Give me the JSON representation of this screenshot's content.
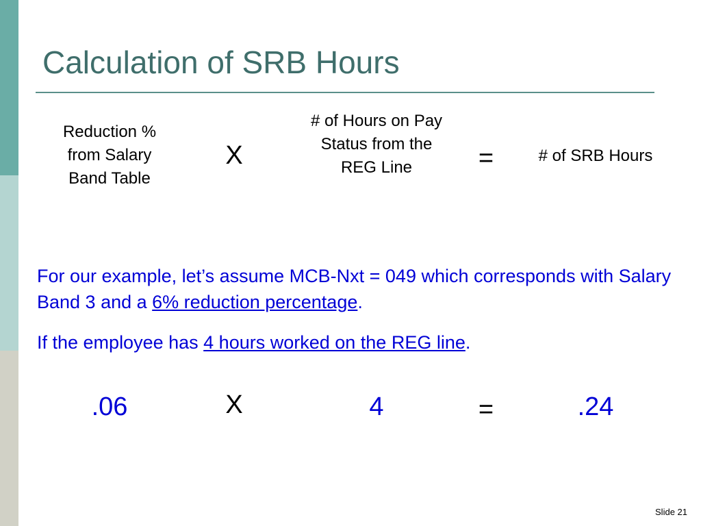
{
  "slide": {
    "title": "Calculation of SRB Hours",
    "formula": {
      "term1": "Reduction % from Salary Band Table",
      "operator1": "X",
      "term2": "# of Hours on Pay Status from the REG Line",
      "operator2": "=",
      "result": "# of SRB Hours"
    },
    "example": {
      "para1_text": "For our example, let’s assume MCB-Nxt = 049 which corresponds with Salary Band 3 and a ",
      "para1_link": "6% reduction percentage",
      "para1_end": ".",
      "para2_text": "If the employee has ",
      "para2_link": "4 hours worked on the REG line",
      "para2_end": "."
    },
    "calculation": {
      "value1": ".06",
      "operator1": "X",
      "value2": "4",
      "operator2": "=",
      "result": ".24"
    },
    "footer": "Slide 21"
  },
  "colors": {
    "title": "#3f6e6b",
    "accent_blue": "#0000d6",
    "sidebar_top": "#6aada6",
    "sidebar_mid": "#b4d5d1",
    "sidebar_bottom": "#d1d1c6"
  }
}
